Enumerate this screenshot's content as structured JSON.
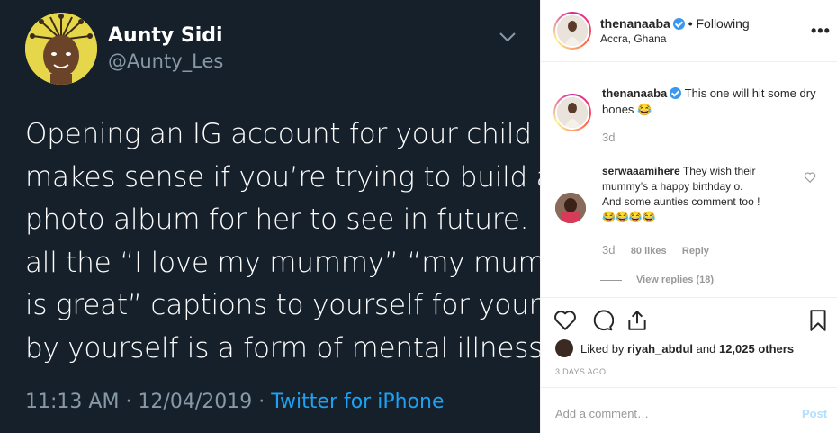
{
  "tweet": {
    "name": "Aunty Sidi",
    "handle": "@Aunty_Les",
    "text_lines": [
      "Opening an IG account for your child",
      "makes sense if you’re trying to build a",
      "photo album for her to see in future. But",
      "all the “I love my mummy” “my mummy",
      "is great” captions to yourself for yourself",
      "by yourself is a form of mental illness."
    ],
    "time": "11:13 AM",
    "date": "12/04/2019",
    "separator": "·",
    "source": "Twitter for iPhone",
    "menu_icon": "chevron-down-icon"
  },
  "instagram": {
    "header": {
      "username": "thenanaaba",
      "separator": "•",
      "follow_status": "Following",
      "location": "Accra, Ghana",
      "more_label": "•••"
    },
    "caption": {
      "username": "thenanaaba",
      "text": "This one will hit some dry bones 😂",
      "time": "3d"
    },
    "comment": {
      "username": "serwaaamihere",
      "text": "They wish their mummy’s a happy birthday o.",
      "text2": "And some aunties comment too !",
      "emojis": "😂😂😂😂",
      "time": "3d",
      "likes": "80 likes",
      "reply_label": "Reply",
      "view_replies": "View replies (18)"
    },
    "likes": {
      "prefix": "Liked by",
      "user": "riyah_abdul",
      "mid": "and",
      "others": "12,025 others"
    },
    "posted": "3 DAYS AGO",
    "add_comment_placeholder": "Add a comment…",
    "post_label": "Post",
    "colors": {
      "twitter_bg": "#15202b",
      "twitter_link": "#1da1f2",
      "verified": "#3897f0"
    }
  }
}
